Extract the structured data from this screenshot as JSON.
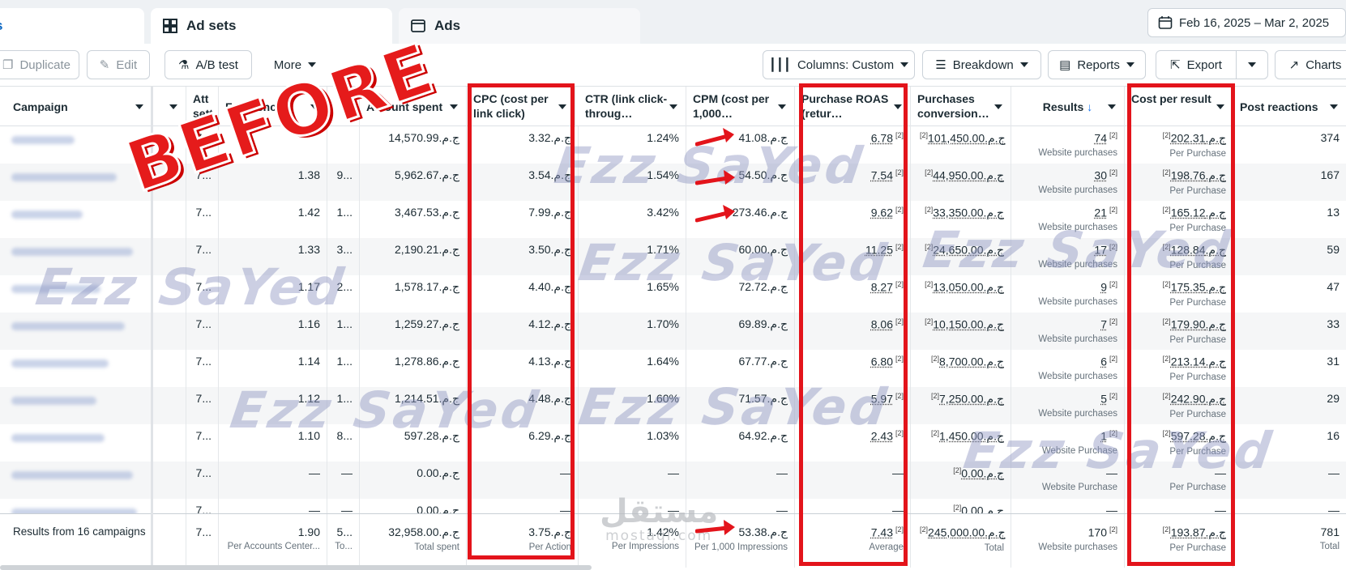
{
  "tabs": [
    {
      "label": "s"
    },
    {
      "label": "Ad sets"
    },
    {
      "label": "Ads"
    }
  ],
  "date_range": "Feb 16, 2025 – Mar 2, 2025",
  "toolbar": {
    "duplicate": "Duplicate",
    "edit": "Edit",
    "ab_test": "A/B test",
    "more": "More",
    "columns": "Columns: Custom",
    "breakdown": "Breakdown",
    "reports": "Reports",
    "export": "Export",
    "charts": "Charts"
  },
  "headers": {
    "campaign": "Campaign",
    "attribution": "Att sett",
    "frequency": "Frequency",
    "amount_spent": "Amount spent",
    "cpc": "CPC (cost per link click)",
    "ctr": "CTR (link click-throug…",
    "cpm": "CPM (cost per 1,000…",
    "roas": "Purchase ROAS (retur…",
    "purchases_value": "Purchases conversion…",
    "results": "Results",
    "results_sort": "↓",
    "cost_per_result": "Cost per result",
    "post_reactions": "Post reactions"
  },
  "rows": [
    {
      "att": "7...",
      "freq": "",
      "reach": "",
      "spent": "ج.م.14,570.99",
      "cpc": "ج.م.3.32",
      "ctr": "1.24%",
      "cpm": "ج.م.41.08",
      "roas": "6.78",
      "pv": "ج.م.101,450.00",
      "res": "74",
      "res_sub": "Website purchases",
      "cpr": "ج.م.202.31",
      "cpr_sub": "Per Purchase",
      "react": "374"
    },
    {
      "att": "7...",
      "freq": "1.38",
      "reach": "9...",
      "spent": "ج.م.5,962.67",
      "cpc": "ج.م.3.54",
      "ctr": "1.54%",
      "cpm": "ج.م.54.50",
      "roas": "7.54",
      "pv": "ج.م.44,950.00",
      "res": "30",
      "res_sub": "Website purchases",
      "cpr": "ج.م.198.76",
      "cpr_sub": "Per Purchase",
      "react": "167"
    },
    {
      "att": "7...",
      "freq": "1.42",
      "reach": "1...",
      "spent": "ج.م.3,467.53",
      "cpc": "ج.م.7.99",
      "ctr": "3.42%",
      "cpm": "ج.م.273.46",
      "roas": "9.62",
      "pv": "ج.م.33,350.00",
      "res": "21",
      "res_sub": "Website purchases",
      "cpr": "ج.م.165.12",
      "cpr_sub": "Per Purchase",
      "react": "13"
    },
    {
      "att": "7...",
      "freq": "1.33",
      "reach": "3...",
      "spent": "ج.م.2,190.21",
      "cpc": "ج.م.3.50",
      "ctr": "1.71%",
      "cpm": "ج.م.60.00",
      "roas": "11.25",
      "pv": "ج.م.24,650.00",
      "res": "17",
      "res_sub": "Website purchases",
      "cpr": "ج.م.128.84",
      "cpr_sub": "Per Purchase",
      "react": "59"
    },
    {
      "att": "7...",
      "freq": "1.17",
      "reach": "2...",
      "spent": "ج.م.1,578.17",
      "cpc": "ج.م.4.40",
      "ctr": "1.65%",
      "cpm": "ج.م.72.72",
      "roas": "8.27",
      "pv": "ج.م.13,050.00",
      "res": "9",
      "res_sub": "Website purchases",
      "cpr": "ج.م.175.35",
      "cpr_sub": "Per Purchase",
      "react": "47"
    },
    {
      "att": "7...",
      "freq": "1.16",
      "reach": "1...",
      "spent": "ج.م.1,259.27",
      "cpc": "ج.م.4.12",
      "ctr": "1.70%",
      "cpm": "ج.م.69.89",
      "roas": "8.06",
      "pv": "ج.م.10,150.00",
      "res": "7",
      "res_sub": "Website purchases",
      "cpr": "ج.م.179.90",
      "cpr_sub": "Per Purchase",
      "react": "33"
    },
    {
      "att": "7...",
      "freq": "1.14",
      "reach": "1...",
      "spent": "ج.م.1,278.86",
      "cpc": "ج.م.4.13",
      "ctr": "1.64%",
      "cpm": "ج.م.67.77",
      "roas": "6.80",
      "pv": "ج.م.8,700.00",
      "res": "6",
      "res_sub": "Website purchases",
      "cpr": "ج.م.213.14",
      "cpr_sub": "Per Purchase",
      "react": "31"
    },
    {
      "att": "7...",
      "freq": "1.12",
      "reach": "1...",
      "spent": "ج.م.1,214.51",
      "cpc": "ج.م.4.48",
      "ctr": "1.60%",
      "cpm": "ج.م.71.57",
      "roas": "5.97",
      "pv": "ج.م.7,250.00",
      "res": "5",
      "res_sub": "Website purchases",
      "cpr": "ج.م.242.90",
      "cpr_sub": "Per Purchase",
      "react": "29"
    },
    {
      "att": "7...",
      "freq": "1.10",
      "reach": "8...",
      "spent": "ج.م.597.28",
      "cpc": "ج.م.6.29",
      "ctr": "1.03%",
      "cpm": "ج.م.64.92",
      "roas": "2.43",
      "pv": "ج.م.1,450.00",
      "res": "1",
      "res_sub": "Website Purchase",
      "cpr": "ج.م.597.28",
      "cpr_sub": "Per Purchase",
      "react": "16"
    },
    {
      "att": "7...",
      "freq": "—",
      "reach": "—",
      "spent": "ج.م.0.00",
      "cpc": "—",
      "ctr": "—",
      "cpm": "—",
      "roas": "—",
      "pv": "ج.م.0.00",
      "res": "—",
      "res_sub": "Website Purchase",
      "cpr": "—",
      "cpr_sub": "Per Purchase",
      "react": "—"
    },
    {
      "att": "7...",
      "freq": "—",
      "reach": "—",
      "spent": "ج.م.0.00",
      "cpc": "—",
      "ctr": "—",
      "cpm": "—",
      "roas": "—",
      "pv": "ج.م.0.00",
      "res": "—",
      "res_sub": "",
      "cpr": "—",
      "cpr_sub": "",
      "react": "—"
    }
  ],
  "footer": {
    "label": "Results from 16 campaigns",
    "att": "7...",
    "freq": "1.90",
    "freq_sub": "Per Accounts Center...",
    "reach": "5...",
    "reach_sub": "To...",
    "spent": "ج.م.32,958.00",
    "spent_sub": "Total spent",
    "cpc": "ج.م.3.75",
    "cpc_sub": "Per Action",
    "ctr": "1.42%",
    "ctr_sub": "Per Impressions",
    "cpm": "ج.م.53.38",
    "cpm_sub": "Per 1,000 Impressions",
    "roas": "7.43",
    "roas_sub": "Average",
    "pv": "ج.م.245,000.00",
    "pv_sub": "Total",
    "res": "170",
    "res_sub": "Website purchases",
    "cpr": "ج.م.193.87",
    "cpr_sub": "Per Purchase",
    "react": "781",
    "react_sub": "Total"
  },
  "overlay": {
    "before": "BEFORE",
    "watermark": "Ezz SaYed",
    "mostaql_ar": "مستقل",
    "mostaql_en": "mostaql.com",
    "highlight_color": "#e3141b"
  }
}
